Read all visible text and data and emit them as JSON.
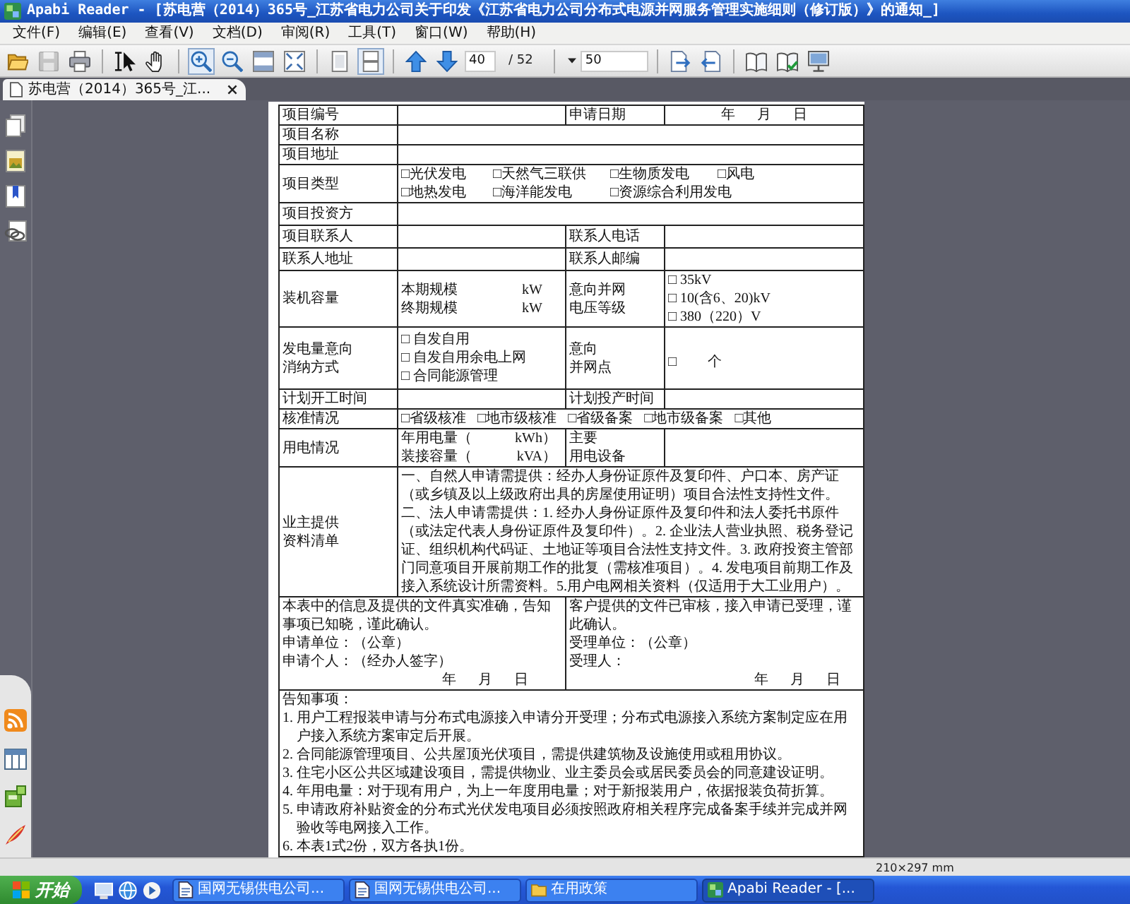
{
  "window": {
    "title": "Apabi Reader - [苏电营（2014）365号_江苏省电力公司关于印发《江苏省电力公司分布式电源并网服务管理实施细则（修订版）》的通知_]"
  },
  "menu": [
    "文件(F)",
    "编辑(E)",
    "查看(V)",
    "文档(D)",
    "审阅(R)",
    "工具(T)",
    "窗口(W)",
    "帮助(H)"
  ],
  "toolbar": {
    "buttons": [
      {
        "selected": false,
        "disabled": false
      },
      {
        "selected": false,
        "disabled": true
      },
      {
        "selected": false,
        "disabled": false
      },
      {
        "selected": false,
        "disabled": false
      },
      {
        "selected": false,
        "disabled": false
      },
      {
        "selected": true,
        "disabled": false
      },
      {
        "selected": false,
        "disabled": false
      },
      {
        "selected": false,
        "disabled": false
      },
      {
        "selected": false,
        "disabled": false
      },
      {
        "selected": false,
        "disabled": false
      },
      {
        "selected": true,
        "disabled": false
      },
      {
        "selected": false,
        "disabled": false
      },
      {
        "selected": false,
        "disabled": false
      },
      {
        "selected": false,
        "disabled": false
      },
      {
        "selected": false,
        "disabled": false
      },
      {
        "selected": false,
        "disabled": false
      },
      {
        "selected": false,
        "disabled": false
      },
      {
        "selected": false,
        "disabled": false
      }
    ],
    "page_field": {
      "value": "40"
    },
    "page_total": "/ 52",
    "zoom_field": {
      "value": "50"
    }
  },
  "tabs": [
    {
      "label": "苏电营（2014）365号_江...",
      "selected": true
    }
  ],
  "form": {
    "project_number": "项目编号",
    "apply_date": {
      "label": "申请日期",
      "value": "年 月 日"
    },
    "project_name": "项目名称",
    "project_address": "项目地址",
    "project_type": {
      "label": "项目类型",
      "options": [
        "□光伏发电",
        "□天然气三联供",
        "□生物质发电",
        "□风电",
        "□地热发电",
        "□海洋能发电",
        "□资源综合利用发电"
      ]
    },
    "investor": "项目投资方",
    "contact": {
      "label": "项目联系人",
      "label_2": "联系人电话"
    },
    "contact_address": {
      "label": "联系人地址",
      "label_2": "联系人邮编"
    },
    "capacity": {
      "label": "装机容量",
      "scales": [
        {
          "name": "本期规模",
          "unit": "kW"
        },
        {
          "name": "终期规模",
          "unit": "kW"
        }
      ],
      "voltage_label": "意向并网电压等级",
      "voltage_options": [
        "□ 35kV",
        "□ 10(含6、20)kV",
        "□ 380（220）V"
      ]
    },
    "consumption": {
      "label": "发电量意向消纳方式",
      "options": [
        "□ 自发自用",
        "□ 自发自用余电上网",
        "□ 合同能源管理"
      ],
      "point_label": [
        "意向",
        "并网点"
      ],
      "point_mark": "□",
      "point_unit": "个"
    },
    "schedule": {
      "label": "计划开工时间",
      "label_2": "计划投产时间"
    },
    "approval": {
      "label": "核准情况",
      "options": [
        "□省级核准",
        "□地市级核准",
        "□省级备案",
        "□地市级备案",
        "□其他"
      ]
    },
    "usage": {
      "label": "用电情况",
      "amounts": [
        {
          "name": "年用电量（",
          "unit": "kWh）"
        },
        {
          "name": "装接容量（",
          "unit": "kVA）"
        }
      ],
      "equipment_label": [
        "主要",
        "用电设备"
      ]
    },
    "documents": {
      "label": "业主提供资料清单",
      "paragraphs": [
        "一、自然人申请需提供：经办人身份证原件及复印件、户口本、房产证（或乡镇及以上级政府出具的房屋使用证明）项目合法性支持性文件。",
        "二、法人申请需提供：1. 经办人身份证原件及复印件和法人委托书原件（或法定代表人身份证原件及复印件）。2. 企业法人营业执照、税务登记证、组织机构代码证、土地证等项目合法性支持文件。3. 政府投资主管部门同意项目开展前期工作的批复（需核准项目）。4. 发电项目前期工作及接入系统设计所需资料。5.用户电网相关资料（仅适用于大工业用户）。"
      ]
    },
    "declaration": {
      "applicant": {
        "statement": "本表中的信息及提供的文件真实准确，告知事项已知晓，谨此确认。",
        "lines": [
          "申请单位：（公章）",
          "申请个人：（经办人签字）"
        ],
        "date": "年 月 日"
      },
      "receiver": {
        "statement": "客户提供的文件已审核，接入申请已受理，谨此确认。",
        "lines": [
          "受理单位：（公章）",
          "受理人："
        ],
        "date": "年 月 日"
      }
    },
    "notes": {
      "title": "告知事项：",
      "items": [
        "1. 用户工程报装申请与分布式电源接入申请分开受理；分布式电源接入系统方案制定应在用户接入系统方案审定后开展。",
        "2. 合同能源管理项目、公共屋顶光伏项目，需提供建筑物及设施使用或租用协议。",
        "3. 住宅小区公共区域建设项目，需提供物业、业主委员会或居民委员会的同意建设证明。",
        "4. 年用电量：对于现有用户，为上一年度用电量；对于新报装用户，依据报装负荷折算。",
        "5. 申请政府补贴资金的分布式光伏发电项目必须按照政府相关程序完成备案手续并完成并网验收等电网接入工作。",
        "6. 本表1式2份，双方各执1份。"
      ]
    }
  },
  "status_bar": {
    "page_size": "210×297 mm"
  },
  "taskbar": {
    "start": "开始",
    "tasks": [
      {
        "kind": "document",
        "label": "国网无锡供电公司...",
        "selected": false
      },
      {
        "kind": "document",
        "label": "国网无锡供电公司...",
        "selected": false
      },
      {
        "kind": "folder",
        "label": "在用政策",
        "selected": false
      },
      {
        "kind": "app",
        "label": "Apabi Reader - [...",
        "selected": true
      }
    ]
  }
}
